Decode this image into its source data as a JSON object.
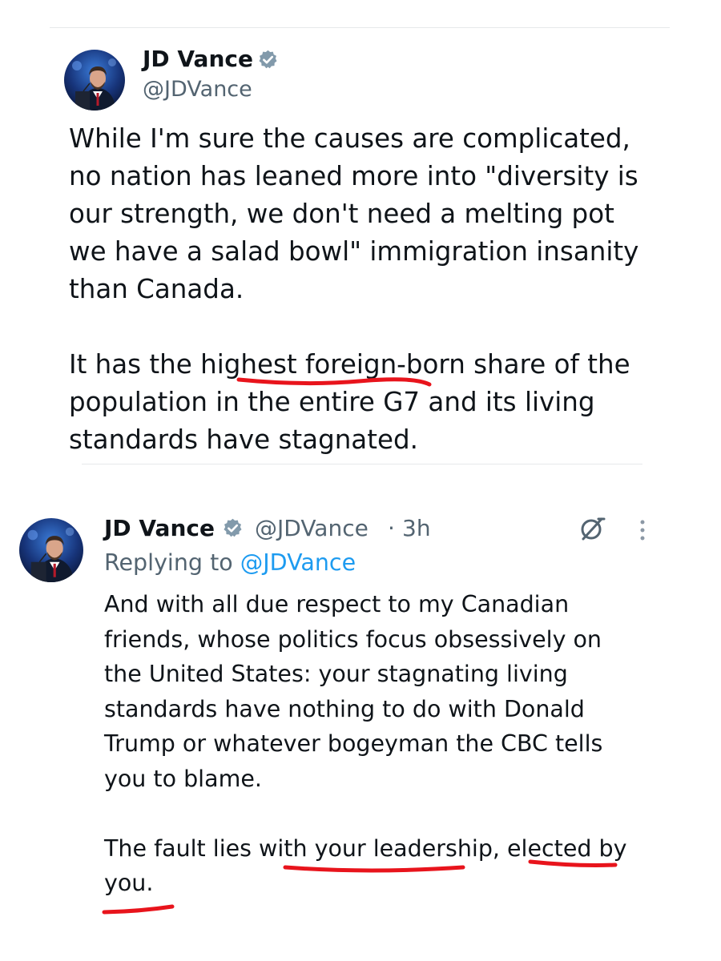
{
  "tweet1": {
    "author_name": "JD Vance",
    "author_handle": "@JDVance",
    "text": "While I'm sure the causes are complicated,\nno nation has leaned more into \"diversity is\nour strength, we don't need a melting pot\nwe have a salad bowl\" immigration insanity\nthan Canada.\n\nIt has the highest foreign-born share of the\npopulation in the entire G7 and its living\nstandards have stagnated."
  },
  "tweet2": {
    "author_name": "JD Vance",
    "author_handle": "@JDVance",
    "separator": "·",
    "timestamp": "3h",
    "replying_prefix": "Replying to",
    "replying_handle": "@JDVance",
    "text": "And with all due respect to my Canadian\nfriends, whose politics focus obsessively on\nthe United States: your stagnating living\nstandards have nothing to do with Donald\nTrump or whatever bogeyman the CBC tells\nyou to blame.\n\nThe fault lies with your leadership, elected by\nyou."
  },
  "icons": {
    "verified": "verified-badge-icon",
    "grok": "grok-icon",
    "more": "more-options-icon"
  },
  "colors": {
    "verified_badge": "#829aab",
    "mention": "#1d9bf0",
    "handle_gray": "#536471",
    "annotation_red": "#e8141c"
  }
}
